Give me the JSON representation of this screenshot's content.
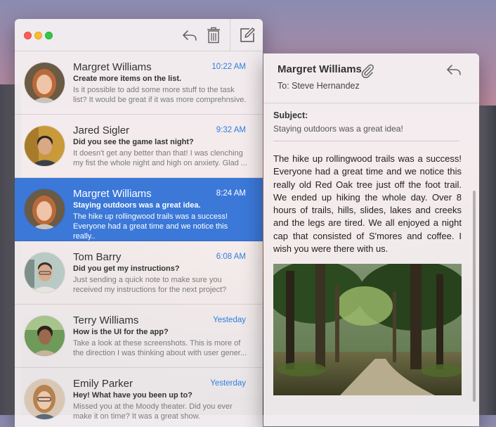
{
  "toolbar": {
    "close": "close-window",
    "minimize": "minimize-window",
    "zoom": "zoom-window",
    "reply_icon": "reply-icon",
    "trash_icon": "trash-icon",
    "compose_icon": "compose-icon"
  },
  "messages": [
    {
      "sender": "Margret Williams",
      "time": "10:22 AM",
      "subject": "Create more items on the list.",
      "preview": "Is it possible to add some more stuff to the task list?  It would be great if it was more comprehnsive."
    },
    {
      "sender": "Jared Sigler",
      "time": "9:32 AM",
      "subject": "Did you see the game last night?",
      "preview": "It doesn't get any better than that!  I was clenching my fist the whole night and high on anxiety.  Glad ..."
    },
    {
      "sender": "Margret Williams",
      "time": "8:24 AM",
      "subject": "Staying outdoors was a great idea.",
      "preview": "The hike up rollingwood trails was a success! Everyone had a great time and we notice this really.."
    },
    {
      "sender": "Tom Barry",
      "time": "6:08 AM",
      "subject": "Did you get my instructions?",
      "preview": "Just sending a quick note to make sure you received my instructions for the next project?"
    },
    {
      "sender": "Terry Williams",
      "time": "Yesteday",
      "subject": "How is the UI for the app?",
      "preview": "Take a look at these screenshots. This is more of the direction I was thinking about with user gener..."
    },
    {
      "sender": "Emily Parker",
      "time": "Yesterday",
      "subject": "Hey!  What have you been up to?",
      "preview": "Missed you at the Moody theater.  Did you ever make it on time? It was a great show."
    }
  ],
  "reader": {
    "from": "Margret Williams",
    "to": "To: Steve Hernandez",
    "subject_label": "Subject:",
    "subject": "Staying outdoors was a great idea!",
    "body": "The hike up rollingwood trails was a success! Everyone had a great time and we notice this really old Red Oak tree just off the foot trail. We ended up hiking the whole day.  Over 8 hours of trails, hills, slides, lakes and creeks and the legs are tired.  We all enjoyed a night cap that consisted of S'mores and coffee.  I wish you were there with us."
  },
  "colors": {
    "accent": "#3b78d8",
    "time_text": "#2f7fe0"
  }
}
